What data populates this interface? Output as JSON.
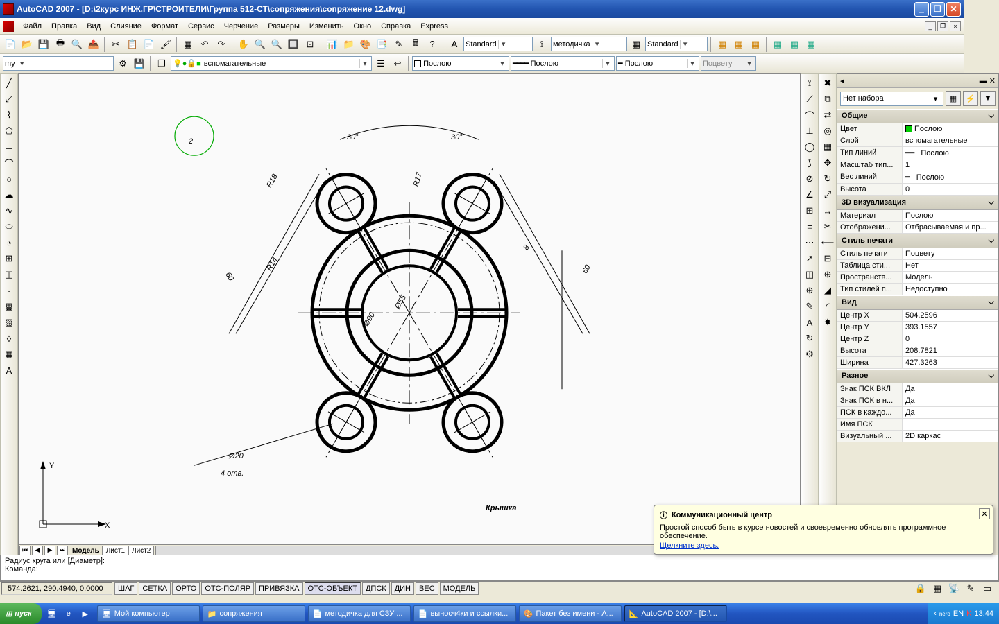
{
  "titlebar": {
    "text": "AutoCAD 2007 - [D:\\2курс ИНЖ.ГР\\СТРОИТЕЛИ\\Группа 512-СТ\\сопряжения\\сопряжение 12.dwg]"
  },
  "menu": [
    "Файл",
    "Правка",
    "Вид",
    "Слияние",
    "Формат",
    "Сервис",
    "Черчение",
    "Размеры",
    "Изменить",
    "Окно",
    "Справка",
    "Express"
  ],
  "toolbar2": {
    "combo1": "my",
    "layer": "вспомагательные",
    "lineColor": "Послою",
    "lineType": "Послою",
    "lineWeight": "Послою",
    "byColour": "Поцвету",
    "textStyle": "Standard",
    "dimStyle": "методичка",
    "tableStyle": "Standard"
  },
  "tabs": {
    "model": "Модель",
    "sheet1": "Лист1",
    "sheet2": "Лист2"
  },
  "drawing": {
    "number": "2",
    "label_R18": "R18",
    "label_R17": "R17",
    "label_R14": "R14",
    "label_30a": "30°",
    "label_30b": "30°",
    "label_60a": "60",
    "label_60b": "60",
    "label_8": "8",
    "label_d55": "Ø55",
    "label_d90": "Ø90",
    "label_d20": "Ø20",
    "label_4otv": "4 отв.",
    "title": "Крышка",
    "ucs_x": "X",
    "ucs_y": "Y"
  },
  "props": {
    "selector": "Нет набора",
    "groups": {
      "general": {
        "title": "Общие",
        "color_k": "Цвет",
        "color_v": "Послою",
        "layer_k": "Слой",
        "layer_v": "вспомагательные",
        "ltype_k": "Тип линий",
        "ltype_v": "Послою",
        "ltscale_k": "Масштаб тип...",
        "ltscale_v": "1",
        "lweight_k": "Вес линий",
        "lweight_v": "Послою",
        "height_k": "Высота",
        "height_v": "0"
      },
      "viz3d": {
        "title": "3D визуализация",
        "mat_k": "Материал",
        "mat_v": "Послою",
        "disp_k": "Отображени...",
        "disp_v": "Отбрасываемая и пр..."
      },
      "print": {
        "title": "Стиль печати",
        "style_k": "Стиль печати",
        "style_v": "Поцвету",
        "table_k": "Таблица сти...",
        "table_v": "Нет",
        "space_k": "Пространств...",
        "space_v": "Модель",
        "stype_k": "Тип стилей п...",
        "stype_v": "Недоступно"
      },
      "view": {
        "title": "Вид",
        "cx_k": "Центр X",
        "cx_v": "504.2596",
        "cy_k": "Центр Y",
        "cy_v": "393.1557",
        "cz_k": "Центр Z",
        "cz_v": "0",
        "h_k": "Высота",
        "h_v": "208.7821",
        "w_k": "Ширина",
        "w_v": "427.3263"
      },
      "misc": {
        "title": "Разное",
        "ucs1_k": "Знак ПСК ВКЛ",
        "ucs1_v": "Да",
        "ucs2_k": "Знак ПСК в н...",
        "ucs2_v": "Да",
        "ucs3_k": "ПСК в каждо...",
        "ucs3_v": "Да",
        "ucs4_k": "Имя ПСК",
        "ucs4_v": "",
        "vis_k": "Визуальный ...",
        "vis_v": "2D каркас"
      }
    }
  },
  "cmdline": {
    "line1": "Радиус круга или [Диаметр]:",
    "line2": "Команда:"
  },
  "status": {
    "coords": "574.2621, 290.4940, 0.0000",
    "btns": [
      "ШАГ",
      "СЕТКА",
      "ОРТО",
      "ОТС-ПОЛЯР",
      "ПРИВЯЗКА",
      "ОТС-ОБЪЕКТ",
      "ДПСК",
      "ДИН",
      "ВЕС",
      "МОДЕЛЬ"
    ]
  },
  "notif": {
    "title": "Коммуникационный центр",
    "body": "Простой способ быть в курсе новостей и своевременно обновлять программное обеспечение.",
    "link": "Щелкните здесь."
  },
  "taskbar": {
    "start": "пуск",
    "tasks": [
      "Мой компьютер",
      "сопряжения",
      "методичка для СЗУ ...",
      "выносч4ки и ссылки...",
      "Пакет без имени - A...",
      "AutoCAD 2007 - [D:\\..."
    ],
    "clock": "13:44"
  }
}
